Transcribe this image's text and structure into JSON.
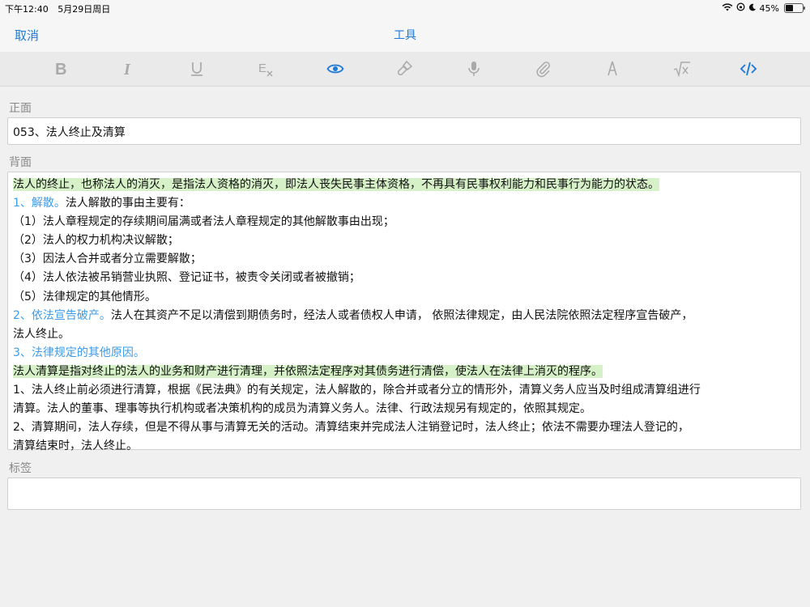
{
  "status": {
    "time": "下午12:40",
    "date": "5月29日周日",
    "battery": "45%",
    "battery_level": 0.45
  },
  "nav": {
    "cancel": "取消",
    "title": "工具"
  },
  "toolbar": {
    "items": [
      "bold-icon",
      "italic-icon",
      "underline-icon",
      "clear-format-icon",
      "eye-icon",
      "brush-icon",
      "mic-icon",
      "paperclip-icon",
      "pen-icon",
      "sqrt-icon",
      "code-icon"
    ],
    "active": [
      "eye-icon",
      "code-icon"
    ],
    "accent": "#1f7ad6",
    "inactive": "#a9a9a9"
  },
  "front": {
    "label": "正面",
    "value": "053、法人终止及清算"
  },
  "back": {
    "label": "背面",
    "intro": "法人的终止，也称法人的消灭，是指法人资格的消灭，即法人丧失民事主体资格，不再具有民事权利能力和民事行为能力的状态。",
    "s1_head": "1、解散。",
    "s1_text": "法人解散的事由主要有：",
    "items": [
      "（1）法人章程规定的存续期间届满或者法人章程规定的其他解散事由出现；",
      "（2）法人的权力机构决议解散；",
      "（3）因法人合并或者分立需要解散；",
      "（4）法人依法被吊销营业执照、登记证书，被责令关闭或者被撤销；",
      "（5）法律规定的其他情形。"
    ],
    "s2_head": "2、依法宣告破产。",
    "s2_text": "法人在其资产不足以清偿到期债务时，经法人或者债权人申请， 依照法律规定，由人民法院依照法定程序宣告破产，",
    "s2_cont": "法人终止。",
    "s3_head": "3、法律规定的其他原因。",
    "liq_def": "法人清算是指对终止的法人的业务和财产进行清理，并依照法定程序对其债务进行清偿，使法人在法律上消灭的程序。",
    "p1_a": "1、法人终止前必须进行清算，根据《民法典》的有关规定，法人解散的，除合并或者分立的情形外，清算义务人应当及时组成清算组进行",
    "p1_b": "清算。法人的董事、理事等执行机构或者决策机构的成员为清算义务人。法律、行政法规另有规定的，依照其规定。",
    "p2_a": "2、清算期间，法人存续，但是不得从事与清算无关的活动。清算结束并完成法人注销登记时，法人终止；依法不需要办理法人登记的，",
    "p2_b": "清算结束时，法人终止。",
    "highlight_color": "#d6f1c8",
    "heading_color": "#3d9be9"
  },
  "tags": {
    "label": "标签",
    "value": ""
  }
}
